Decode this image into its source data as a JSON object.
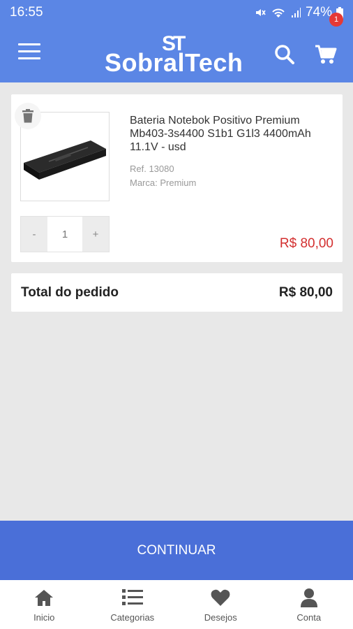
{
  "status_bar": {
    "time": "16:55",
    "battery": "74%"
  },
  "header": {
    "logo_mark": "ST",
    "logo_text": "SobralTech",
    "cart_count": "1"
  },
  "cart_item": {
    "title": "Bateria Notebok Positivo Premium Mb403-3s4400 S1b1 G1l3 4400mAh 11.1V - usd",
    "ref": "Ref. 13080",
    "brand": "Marca: Premium",
    "minus_label": "-",
    "plus_label": "+",
    "quantity": "1",
    "price": "R$ 80,00"
  },
  "order_total": {
    "label": "Total do pedido",
    "value": "R$ 80,00"
  },
  "continue_label": "CONTINUAR",
  "bottom_nav": [
    {
      "label": "Inicio",
      "icon": "home-icon"
    },
    {
      "label": "Categorias",
      "icon": "list-icon"
    },
    {
      "label": "Desejos",
      "icon": "heart-icon"
    },
    {
      "label": "Conta",
      "icon": "user-icon"
    }
  ],
  "colors": {
    "primary": "#5b86e5",
    "button": "#4a6fd8",
    "price": "#d32f2f",
    "badge": "#e53935"
  }
}
